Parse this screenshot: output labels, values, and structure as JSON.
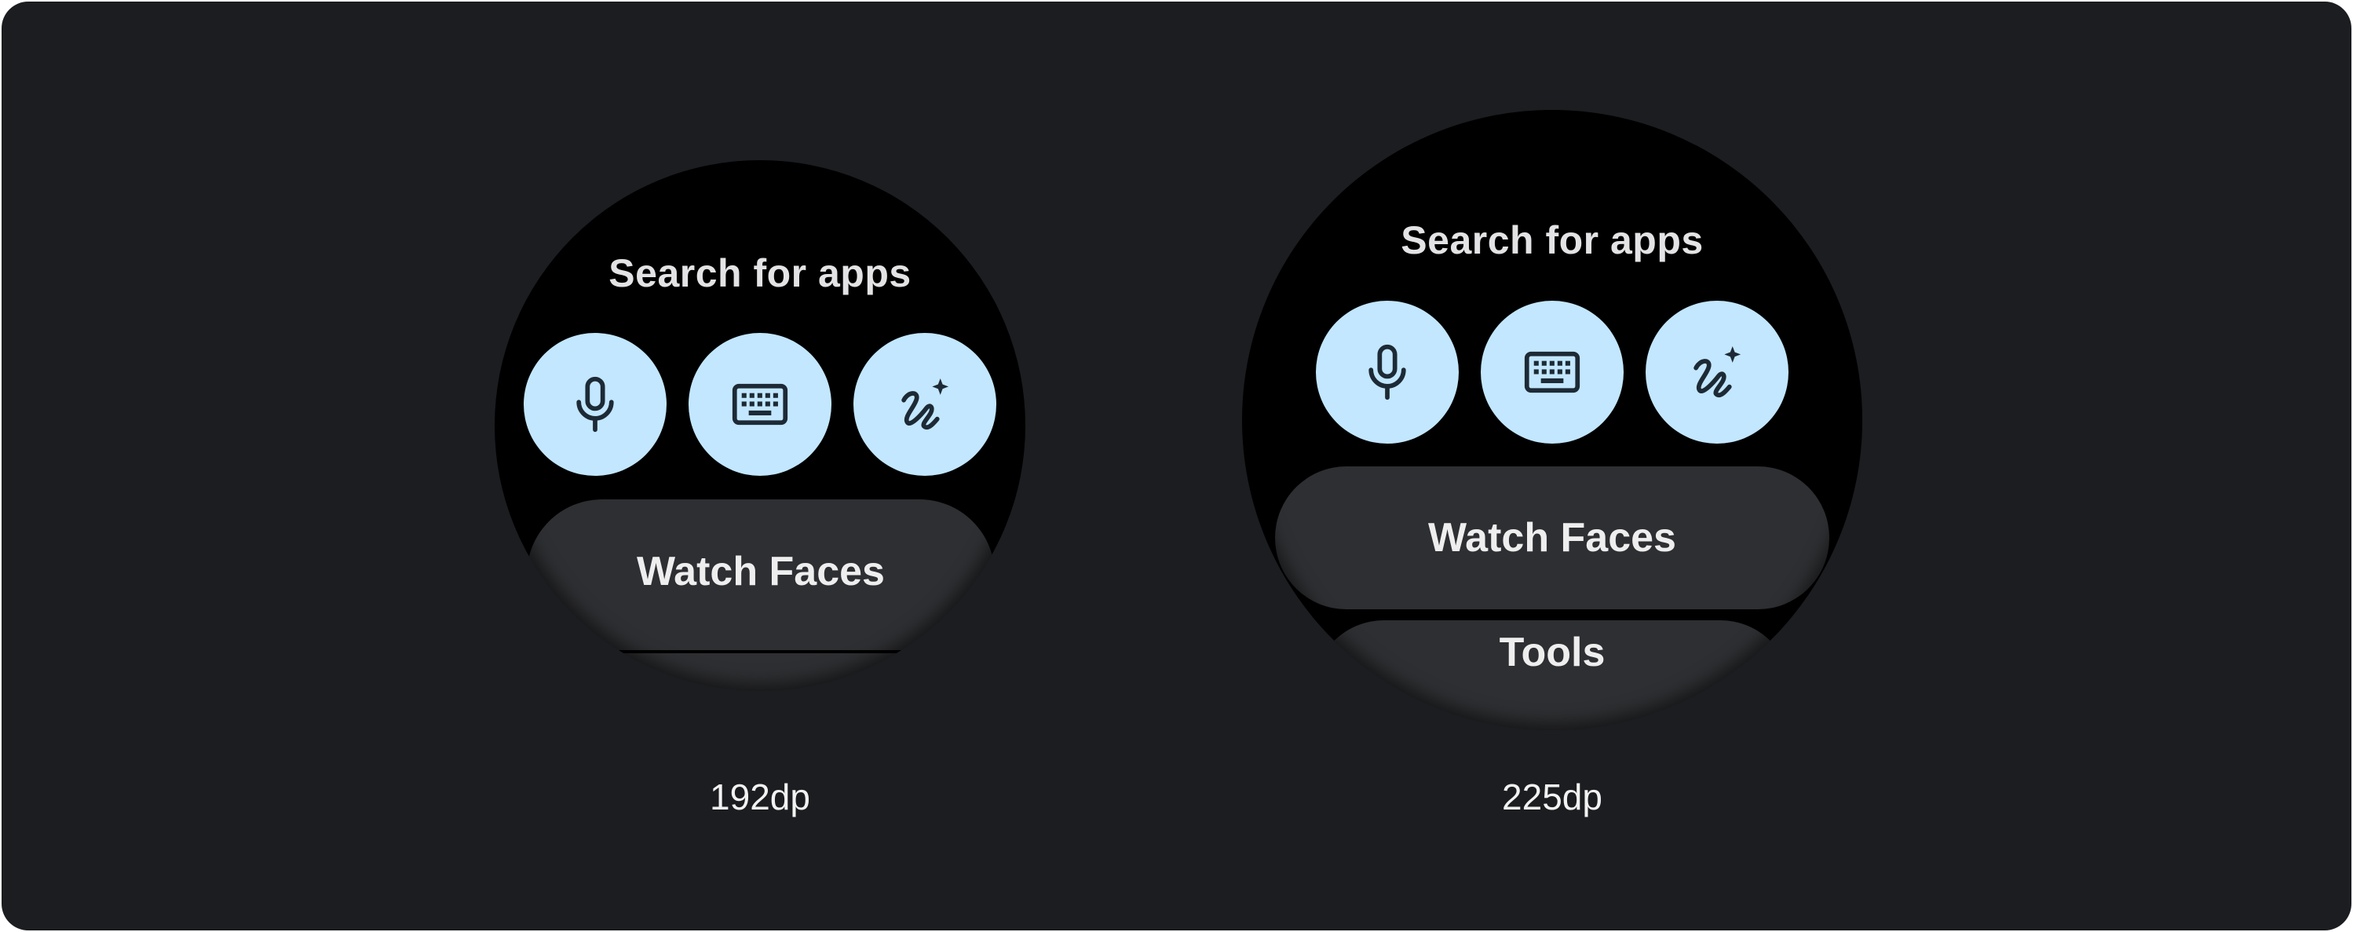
{
  "watches": [
    {
      "title": "Search for apps",
      "buttons": [
        "microphone-icon",
        "keyboard-icon",
        "handwriting-icon"
      ],
      "chips": [
        "Watch Faces",
        ""
      ],
      "size_label": "192dp"
    },
    {
      "title": "Search for apps",
      "buttons": [
        "microphone-icon",
        "keyboard-icon",
        "handwriting-icon"
      ],
      "chips": [
        "Watch Faces",
        "Tools"
      ],
      "size_label": "225dp"
    }
  ],
  "colors": {
    "background": "#1b1d20",
    "watch_face": "#000000",
    "icon_button": "#c2e7ff",
    "chip": "#2e2f32",
    "text": "#e3e3e5"
  }
}
